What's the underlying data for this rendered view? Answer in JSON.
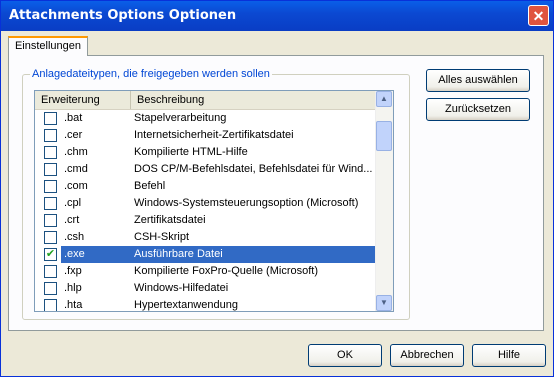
{
  "window": {
    "title": "Attachments Options Optionen",
    "close_glyph": "✕"
  },
  "tab": {
    "label": "Einstellungen"
  },
  "group": {
    "label": "Anlagedateitypen, die freigegeben werden sollen"
  },
  "list": {
    "headers": {
      "ext": "Erweiterung",
      "desc": "Beschreibung"
    },
    "rows": [
      {
        "ext": ".bat",
        "desc": "Stapelverarbeitung",
        "checked": false
      },
      {
        "ext": ".cer",
        "desc": "Internetsicherheit-Zertifikatsdatei",
        "checked": false
      },
      {
        "ext": ".chm",
        "desc": "Kompilierte HTML-Hilfe",
        "checked": false
      },
      {
        "ext": ".cmd",
        "desc": "DOS CP/M-Befehlsdatei, Befehlsdatei für Wind...",
        "checked": false
      },
      {
        "ext": ".com",
        "desc": "Befehl",
        "checked": false
      },
      {
        "ext": ".cpl",
        "desc": "Windows-Systemsteuerungsoption (Microsoft)",
        "checked": false
      },
      {
        "ext": ".crt",
        "desc": "Zertifikatsdatei",
        "checked": false
      },
      {
        "ext": ".csh",
        "desc": "CSH-Skript",
        "checked": false
      },
      {
        "ext": ".exe",
        "desc": "Ausführbare Datei",
        "checked": true,
        "selected": true
      },
      {
        "ext": ".fxp",
        "desc": "Kompilierte FoxPro-Quelle (Microsoft)",
        "checked": false
      },
      {
        "ext": ".hlp",
        "desc": "Windows-Hilfedatei",
        "checked": false
      },
      {
        "ext": ".hta",
        "desc": "Hypertextanwendung",
        "checked": false
      }
    ]
  },
  "buttons": {
    "select_all": "Alles auswählen",
    "reset": "Zurücksetzen",
    "ok": "OK",
    "cancel": "Abbrechen",
    "help": "Hilfe"
  }
}
